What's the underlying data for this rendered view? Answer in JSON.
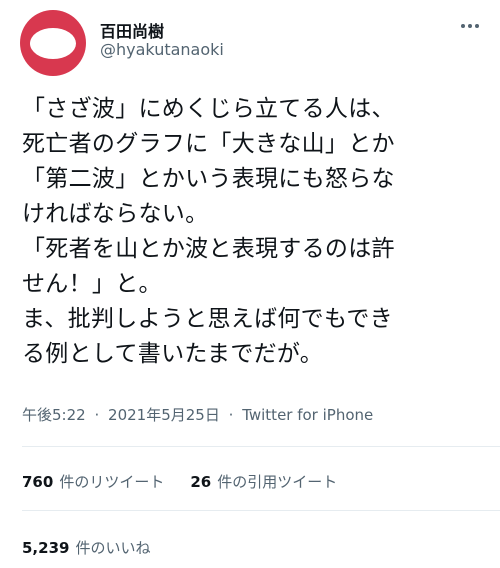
{
  "user": {
    "display_name": "百田尚樹",
    "handle": "@hyakutanaoki",
    "avatar_colors": {
      "ring": "#d8384f",
      "center": "#ffffff"
    }
  },
  "tweet": {
    "text": "「さざ波」にめくじら立てる人は、\n死亡者のグラフに「大きな山」とか\n「第二波」とかいう表現にも怒らな\nければならない。\n「死者を山とか波と表現するのは許\nせん！」と。\nま、批判しようと思えば何でもでき\nる例として書いたまでだが。",
    "time": "午後5:22",
    "separator": "·",
    "date": "2021年5月25日",
    "source": "Twitter for iPhone"
  },
  "stats": {
    "retweets": {
      "count": "760",
      "label": "件のリツイート"
    },
    "quotes": {
      "count": "26",
      "label": "件の引用ツイート"
    },
    "likes": {
      "count": "5,239",
      "label": "件のいいね"
    }
  },
  "icons": {
    "more": "more-horizontal-icon"
  },
  "colors": {
    "text": "#0f1419",
    "secondary": "#536471",
    "divider": "#e6ecf0"
  }
}
